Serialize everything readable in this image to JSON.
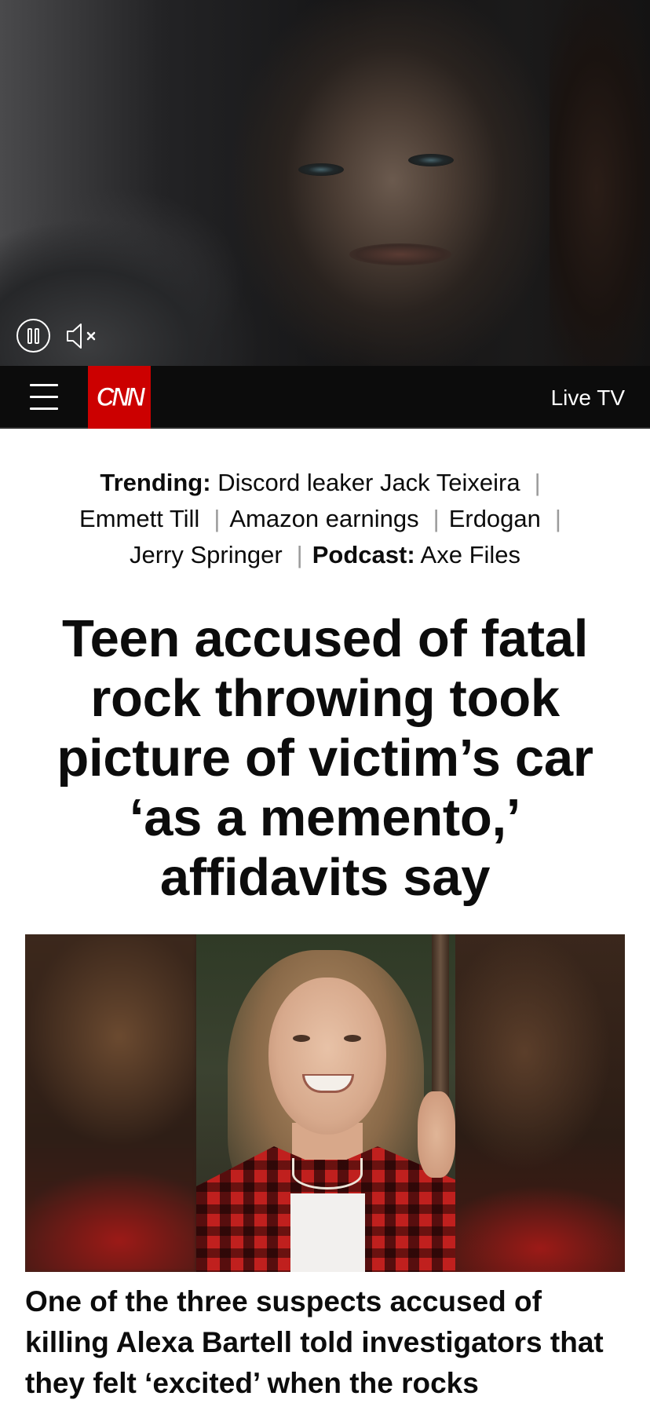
{
  "video": {
    "pause_icon": "pause-icon",
    "mute_icon": "speaker-muted-icon"
  },
  "header": {
    "menu_icon": "hamburger-menu-icon",
    "logo_text": "CNN",
    "live_tv_label": "Live TV",
    "colors": {
      "background": "#0c0c0c",
      "brand_red": "#cc0000"
    }
  },
  "trending": {
    "label": "Trending:",
    "items": [
      "Discord leaker Jack Teixeira",
      "Emmett Till",
      "Amazon earnings",
      "Erdogan",
      "Jerry Springer"
    ],
    "podcast_label": "Podcast:",
    "podcast_name": "Axe Files"
  },
  "article": {
    "headline": "Teen accused of fatal rock throwing took picture of victim’s car ‘as a memento,’ affidavits say",
    "subheadline": "One of the three suspects accused of killing Alexa Bartell told investigators that they felt ‘excited’ when the rocks"
  }
}
